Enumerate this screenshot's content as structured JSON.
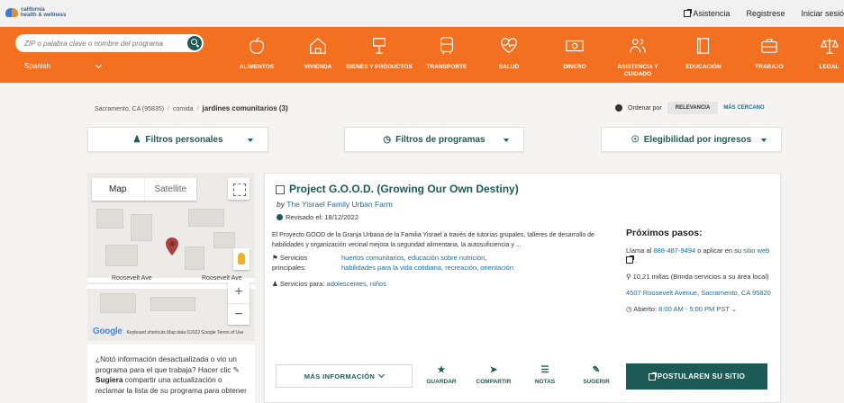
{
  "topbar": {
    "logo_line1": "california",
    "logo_line2": "health & wellness",
    "links": [
      "Asistencia",
      "Registrese",
      "Iniciar sesió"
    ]
  },
  "nav": {
    "search_placeholder": "ZIP o palabra clave o nombre del programa",
    "language": "Spanish",
    "categories": [
      "ALIMENTOS",
      "VIVIENDA",
      "BIENES Y PRODUCTOS",
      "TRANSPORTE",
      "SALUD",
      "DINERO",
      "ASISTENCIA Y\nCUIDADO",
      "EDUCACIÓN",
      "TRABAJO",
      "LEGAL"
    ]
  },
  "breadcrumb": {
    "location": "Sacramento, CA (95835)",
    "category": "comida",
    "current": "jardines comunitarios (3)"
  },
  "sort": {
    "label": "Ordenar por",
    "active": "RELEVANCIA",
    "alt": "MÁS CERCANO"
  },
  "filters": [
    "Filtros personales",
    "Filtros de programas",
    "Elegibilidad por ingresos"
  ],
  "map": {
    "type_map": "Map",
    "type_satellite": "Satellite",
    "street_left": "Roosevelt Ave",
    "street_right": "Roosevelt Ave",
    "google": "Google",
    "footer": "Keyboard shortcuts   Map data ©2022 Google   Terms of Use",
    "zoom_in": "+",
    "zoom_out": "−"
  },
  "suggest": {
    "text1": "¿Notó información desactualizada o vio un programa para el que trabaja? Hacer clic",
    "bold": "Sugiera",
    "text2": "compartir una actualización o reclamar la lista de su programa para obtener"
  },
  "result": {
    "title": "Project G.O.O.D. (Growing Our Own Destiny)",
    "by_prefix": "by",
    "provider": "The Yisrael Family Urban Farm",
    "reviewed": "Revisado el: 18/12/2022",
    "description": "El Proyecto GOOD de la Granja Urbana de la Familia Yisrael a través de tutorías grupales, talleres de desarrollo de habilidades y organización vecinal mejora la seguridad alimentaria, la autosuficiencia y ...",
    "services_label": "Servicios principales:",
    "services": [
      "huertos comunitarios",
      "educación sobre nutrición",
      "habilidades para la vida cotidiana",
      "recreación",
      "orientación"
    ],
    "serves_label": "Servicios para:",
    "serves": [
      "adolescentes",
      "niños"
    ],
    "next_title": "Próximos pasos:",
    "call_prefix": "Llama al",
    "phone": "888-487-9494",
    "call_mid": "o aplicar en su",
    "site": "sitio web",
    "distance": "10,21 millas (Brinda servicios a su área local)",
    "address": "4507 Roosevelt Avenue, Sacramento, CA 95820",
    "open_label": "Abierto:",
    "hours": "8:00 AM - 5:00 PM PST",
    "more_info": "MÁS INFORMACIÓN",
    "actions": [
      "GUARDAR",
      "COMPARTIR",
      "NOTAS",
      "SUGERIR"
    ],
    "apply": "POSTULAREN SU SITIO"
  }
}
